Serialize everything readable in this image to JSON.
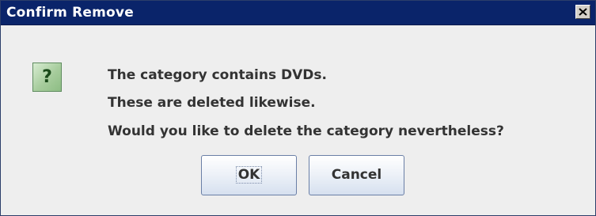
{
  "window": {
    "title": "Confirm Remove",
    "close_icon": "close-icon"
  },
  "dialog": {
    "icon": "question-icon",
    "icon_glyph": "?",
    "messages": [
      "The category contains DVDs.",
      "These are deleted likewise.",
      "Would you like to delete the category nevertheless?"
    ]
  },
  "buttons": {
    "ok_label": "OK",
    "cancel_label": "Cancel"
  },
  "colors": {
    "titlebar": "#0a246a",
    "background": "#eeeeee",
    "icon_green": "#a6cc9c"
  }
}
